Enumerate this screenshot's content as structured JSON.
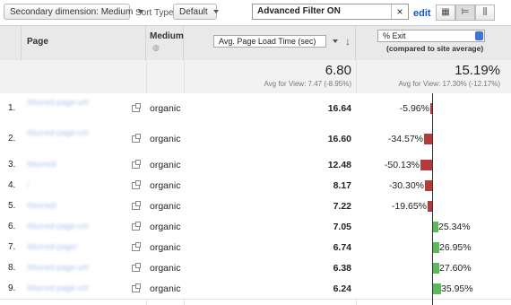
{
  "toolbar": {
    "secondary_dimension": "Secondary dimension: Medium",
    "sort_type_label": "Sort Type:",
    "sort_type_value": "Default",
    "filter_text": "Advanced Filter ON",
    "filter_clear": "×",
    "edit_label": "edit"
  },
  "header": {
    "page_col": "Page",
    "medium_col": "Medium",
    "metric_select": "Avg. Page Load Time (sec)",
    "compare_select": "% Exit",
    "compare_caption": "(compared to site average)"
  },
  "summary": {
    "load_value": "6.80",
    "load_sub": "Avg for View: 7.47 (-8.95%)",
    "exit_value": "15.19%",
    "exit_sub": "Avg for View: 17.30% (-12.17%)"
  },
  "rows": [
    {
      "index": "1.",
      "medium": "organic",
      "load": "16.64",
      "exit": "-5.96%",
      "exit_num": -5.96
    },
    {
      "index": "2.",
      "medium": "organic",
      "load": "16.60",
      "exit": "-34.57%",
      "exit_num": -34.57
    },
    {
      "index": "3.",
      "medium": "organic",
      "load": "12.48",
      "exit": "-50.13%",
      "exit_num": -50.13
    },
    {
      "index": "4.",
      "medium": "organic",
      "load": "8.17",
      "exit": "-30.30%",
      "exit_num": -30.3
    },
    {
      "index": "5.",
      "medium": "organic",
      "load": "7.22",
      "exit": "-19.65%",
      "exit_num": -19.65
    },
    {
      "index": "6.",
      "medium": "organic",
      "load": "7.05",
      "exit": "25.34%",
      "exit_num": 25.34
    },
    {
      "index": "7.",
      "medium": "organic",
      "load": "6.74",
      "exit": "26.95%",
      "exit_num": 26.95
    },
    {
      "index": "8.",
      "medium": "organic",
      "load": "6.38",
      "exit": "27.60%",
      "exit_num": 27.6
    },
    {
      "index": "9.",
      "medium": "organic",
      "load": "6.24",
      "exit": "35.95%",
      "exit_num": 35.95
    }
  ],
  "colors": {
    "negative_bar": "#b53a3a",
    "positive_bar": "#5cb85c",
    "link": "#1155cc"
  }
}
